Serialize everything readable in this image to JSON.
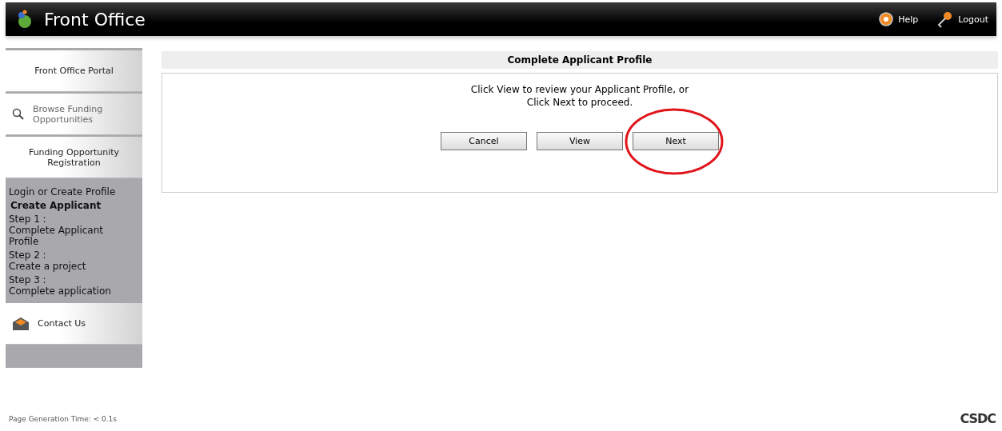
{
  "header": {
    "title": "Front Office",
    "links": [
      {
        "kind": "help",
        "label": "Help"
      },
      {
        "kind": "logout",
        "label": "Logout"
      }
    ]
  },
  "sidebar": {
    "nav": [
      {
        "kind": "plain",
        "label": "Front Office Portal"
      },
      {
        "kind": "search",
        "label": "Browse Funding Opportunities"
      },
      {
        "kind": "plain",
        "label": "Funding Opportunity Registration"
      }
    ],
    "progress": [
      {
        "kind": "text",
        "label": "Login or Create Profile"
      },
      {
        "kind": "heading",
        "label": "Create Applicant"
      },
      {
        "kind": "step",
        "label": "Step 1 :",
        "text": "Complete Applicant Profile"
      },
      {
        "kind": "step",
        "label": "Step 2 :",
        "text": "Create a project"
      },
      {
        "kind": "step",
        "label": "Step 3 :",
        "text": "Complete application"
      }
    ],
    "contact": {
      "label": "Contact Us"
    }
  },
  "main": {
    "title": "Complete Applicant Profile",
    "message": [
      "Click View to review your Applicant Profile, or",
      "Click Next to proceed."
    ],
    "buttons": [
      {
        "label": "Cancel",
        "circled": false
      },
      {
        "label": "View",
        "circled": false
      },
      {
        "label": "Next",
        "circled": true
      }
    ]
  },
  "footer": {
    "generation_time": "Page Generation Time: < 0.1s",
    "logo": "CSDC"
  }
}
